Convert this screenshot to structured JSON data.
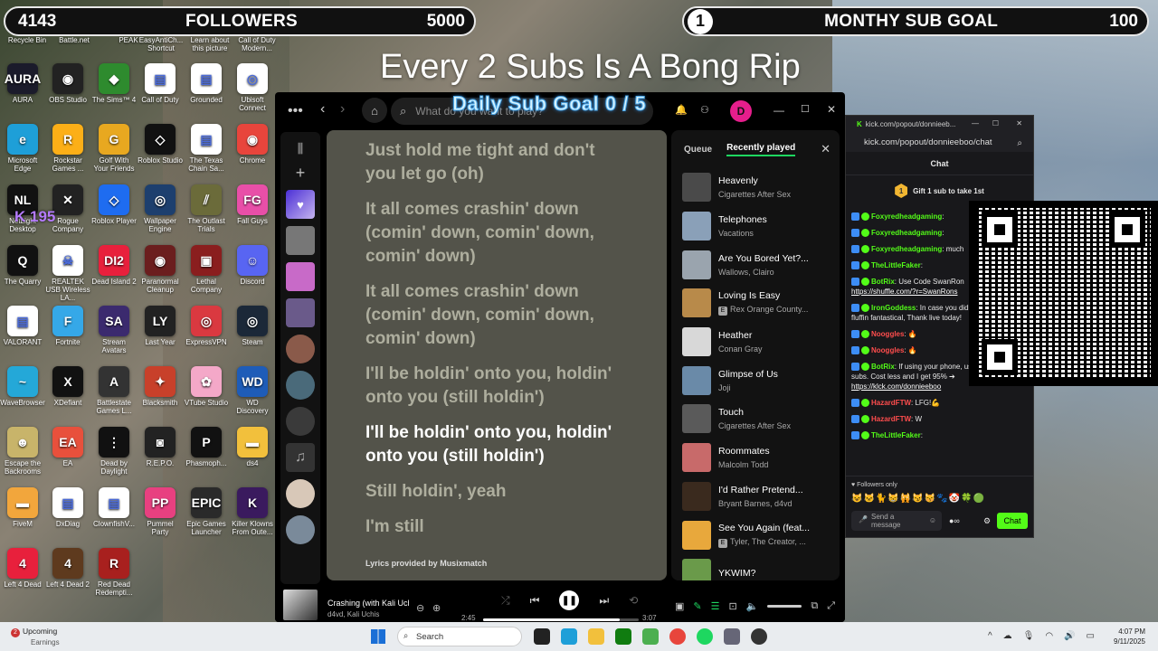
{
  "followers_bar": {
    "current": "4143",
    "title": "FOLLOWERS",
    "goal": "5000"
  },
  "sub_goal_bar": {
    "current": "1",
    "title": "MONTHY SUB GOAL",
    "goal": "100"
  },
  "overlay": {
    "caption": "Every 2 Subs Is A Bong Rip",
    "daily_goal": "Daily Sub Goal  0 / 5",
    "k_label": "K 195"
  },
  "desktop": {
    "top_row": [
      "Recycle Bin",
      "Battle.net",
      "PEAK",
      "EasyAntiCh... Shortcut",
      "Learn about this picture",
      "Call of Duty Modern..."
    ],
    "icons": [
      {
        "label": "AURA",
        "icon": "aura-icon",
        "color": "#1b1b2b",
        "text": "AURA"
      },
      {
        "label": "OBS Studio",
        "icon": "obs-icon",
        "color": "#222222",
        "text": "◉"
      },
      {
        "label": "The Sims™ 4",
        "icon": "sims-icon",
        "color": "#2e8b2e",
        "text": "◆"
      },
      {
        "label": "Call of Duty",
        "icon": "cod-icon",
        "color": "#ffffff",
        "text": "▤"
      },
      {
        "label": "Grounded",
        "icon": "grounded-icon",
        "color": "#ffffff",
        "text": "▤"
      },
      {
        "label": "Ubisoft Connect",
        "icon": "ubisoft-icon",
        "color": "#ffffff",
        "text": "◎"
      },
      {
        "label": "Microsoft Edge",
        "icon": "edge-icon",
        "color": "#1e9fd8",
        "text": "e"
      },
      {
        "label": "Rockstar Games ...",
        "icon": "rockstar-icon",
        "color": "#fcaf17",
        "text": "R"
      },
      {
        "label": "Golf With Your Friends",
        "icon": "golf-icon",
        "color": "#e8a820",
        "text": "G"
      },
      {
        "label": "Roblox Studio",
        "icon": "roblox-studio-icon",
        "color": "#111111",
        "text": "◇"
      },
      {
        "label": "The Texas Chain Sa...",
        "icon": "texas-icon",
        "color": "#ffffff",
        "text": "▤"
      },
      {
        "label": "Chrome",
        "icon": "chrome-icon",
        "color": "#e8453c",
        "text": "◉"
      },
      {
        "label": "NetLight Desktop",
        "icon": "nl-icon",
        "color": "#111111",
        "text": "NL"
      },
      {
        "label": "Rogue Company",
        "icon": "rogue-icon",
        "color": "#222222",
        "text": "✕"
      },
      {
        "label": "Roblox Player",
        "icon": "roblox-icon",
        "color": "#1e6cf0",
        "text": "◇"
      },
      {
        "label": "Wallpaper Engine",
        "icon": "wallpaper-icon",
        "color": "#1d3f6e",
        "text": "◎"
      },
      {
        "label": "The Outlast Trials",
        "icon": "outlast-icon",
        "color": "#6b6b3a",
        "text": "⫽"
      },
      {
        "label": "Fall Guys",
        "icon": "fallguys-icon",
        "color": "#e84fa8",
        "text": "FG"
      },
      {
        "label": "The Quarry",
        "icon": "quarry-icon",
        "color": "#111111",
        "text": "Q"
      },
      {
        "label": "REALTEK USB Wireless LA...",
        "icon": "realtek-icon",
        "color": "#ffffff",
        "text": "☠"
      },
      {
        "label": "Dead Island 2",
        "icon": "deadisland-icon",
        "color": "#e8203c",
        "text": "DI2"
      },
      {
        "label": "Paranormal Cleanup",
        "icon": "paranormal-icon",
        "color": "#6b1e1e",
        "text": "◉"
      },
      {
        "label": "Lethal Company",
        "icon": "lethal-icon",
        "color": "#8a1e1e",
        "text": "▣"
      },
      {
        "label": "Discord",
        "icon": "discord-icon",
        "color": "#5865f2",
        "text": "☺"
      },
      {
        "label": "VALORANT",
        "icon": "valorant-icon",
        "color": "#ffffff",
        "text": "▤"
      },
      {
        "label": "Fortnite",
        "icon": "fortnite-icon",
        "color": "#35a8e8",
        "text": "F"
      },
      {
        "label": "Stream Avatars",
        "icon": "streamavatars-icon",
        "color": "#3b2a6e",
        "text": "SA"
      },
      {
        "label": "Last Year",
        "icon": "lastyear-icon",
        "color": "#222222",
        "text": "LY"
      },
      {
        "label": "ExpressVPN",
        "icon": "expressvpn-icon",
        "color": "#da3940",
        "text": "◎"
      },
      {
        "label": "Steam",
        "icon": "steam-icon",
        "color": "#1b2838",
        "text": "◎"
      },
      {
        "label": "WaveBrowser",
        "icon": "wave-icon",
        "color": "#24a8d8",
        "text": "~"
      },
      {
        "label": "XDefiant",
        "icon": "xdefiant-icon",
        "color": "#111111",
        "text": "X"
      },
      {
        "label": "Battlestate Games L...",
        "icon": "battlestate-icon",
        "color": "#333333",
        "text": "A"
      },
      {
        "label": "Blacksmith",
        "icon": "blacksmith-icon",
        "color": "#c8402a",
        "text": "✦"
      },
      {
        "label": "VTube Studio",
        "icon": "vtube-icon",
        "color": "#f4a8c8",
        "text": "✿"
      },
      {
        "label": "WD Discovery",
        "icon": "wd-icon",
        "color": "#1e5cb8",
        "text": "WD"
      },
      {
        "label": "Escape the Backrooms",
        "icon": "backrooms-icon",
        "color": "#c8b46a",
        "text": "☻"
      },
      {
        "label": "EA",
        "icon": "ea-icon",
        "color": "#e8503c",
        "text": "EA"
      },
      {
        "label": "Dead by Daylight",
        "icon": "dbd-icon",
        "color": "#111111",
        "text": "⋮"
      },
      {
        "label": "R.E.P.O.",
        "icon": "repo-icon",
        "color": "#222222",
        "text": "◙"
      },
      {
        "label": "Phasmoph...",
        "icon": "phasmo-icon",
        "color": "#111111",
        "text": "P"
      },
      {
        "label": "ds4",
        "icon": "folder-icon",
        "color": "#f2c03c",
        "text": "▬"
      },
      {
        "label": "FiveM",
        "icon": "fivem-icon",
        "color": "#f2a63c",
        "text": "▬"
      },
      {
        "label": "DxDiag",
        "icon": "dxdiag-icon",
        "color": "#ffffff",
        "text": "▤"
      },
      {
        "label": "ClownfishV...",
        "icon": "clownfish-icon",
        "color": "#ffffff",
        "text": "▤"
      },
      {
        "label": "Pummel Party",
        "icon": "pummel-icon",
        "color": "#e84080",
        "text": "PP"
      },
      {
        "label": "Epic Games Launcher",
        "icon": "epic-icon",
        "color": "#2a2a2a",
        "text": "EPIC"
      },
      {
        "label": "Killer Klowns From Oute...",
        "icon": "klowns-icon",
        "color": "#3a1a5e",
        "text": "K"
      },
      {
        "label": "Left 4 Dead",
        "icon": "l4d-icon",
        "color": "#e8203c",
        "text": "4"
      },
      {
        "label": "Left 4 Dead 2",
        "icon": "l4d2-icon",
        "color": "#5e3a1e",
        "text": "4"
      },
      {
        "label": "Red Dead Redempti...",
        "icon": "rdr-icon",
        "color": "#a8201e",
        "text": "R"
      }
    ]
  },
  "spotify": {
    "search_placeholder": "What do you want to play?",
    "avatar_letter": "D",
    "lyrics": [
      {
        "text": "Just hold me tight and don't you let go (oh)",
        "active": false
      },
      {
        "text": "It all comes crashin' down (comin' down, comin' down, comin' down)",
        "active": false
      },
      {
        "text": "It all comes crashin' down (comin' down, comin' down, comin' down)",
        "active": false
      },
      {
        "text": "I'll be holdin' onto you, holdin' onto you (still holdin')",
        "active": false
      },
      {
        "text": "I'll be holdin' onto you, holdin' onto you (still holdin')",
        "active": true
      },
      {
        "text": "Still holdin', yeah",
        "active": false
      },
      {
        "text": "I'm still",
        "active": false
      }
    ],
    "lyrics_credit": "Lyrics provided by Musixmatch",
    "queue_tabs": [
      "Queue",
      "Recently played"
    ],
    "recently_played": [
      {
        "title": "Heavenly",
        "artist": "Cigarettes After Sex",
        "explicit": false,
        "color": "#4a4a4a"
      },
      {
        "title": "Telephones",
        "artist": "Vacations",
        "explicit": false,
        "color": "#8aa0b8"
      },
      {
        "title": "Are You Bored Yet?...",
        "artist": "Wallows, Clairo",
        "explicit": false,
        "color": "#9aa4ae"
      },
      {
        "title": "Loving Is Easy",
        "artist": "Rex Orange County...",
        "explicit": true,
        "color": "#b88a4a"
      },
      {
        "title": "Heather",
        "artist": "Conan Gray",
        "explicit": false,
        "color": "#d8d8d8"
      },
      {
        "title": "Glimpse of Us",
        "artist": "Joji",
        "explicit": false,
        "color": "#6a8aa8"
      },
      {
        "title": "Touch",
        "artist": "Cigarettes After Sex",
        "explicit": false,
        "color": "#5a5a5a"
      },
      {
        "title": "Roommates",
        "artist": "Malcolm Todd",
        "explicit": false,
        "color": "#c86a6a"
      },
      {
        "title": "I'd Rather Pretend...",
        "artist": "Bryant Barnes, d4vd",
        "explicit": false,
        "color": "#3a2a1e"
      },
      {
        "title": "See You Again (feat...",
        "artist": "Tyler, The Creator, ...",
        "explicit": true,
        "color": "#e8a83c"
      },
      {
        "title": "YKWIM?",
        "artist": "",
        "explicit": false,
        "color": "#6a9a4a"
      }
    ],
    "now_playing": {
      "title": "Crashing (with Kali Uchis)",
      "artist": "d4vd, Kali Uchis",
      "elapsed": "2:45",
      "duration": "3:07",
      "progress": 0.88
    }
  },
  "kick": {
    "window_title": "kick.com/popout/donnieeb...",
    "address": "kick.com/popout/donnieeboo/chat",
    "chat_header": "Chat",
    "gift_text": "Gift 1 sub to take 1st",
    "gift_coin": "1",
    "messages": [
      {
        "user": "Foxyredheadgaming",
        "text": "",
        "style": "normal"
      },
      {
        "user": "Foxyredheadgaming",
        "text": "",
        "style": "normal"
      },
      {
        "user": "Foxyredheadgaming",
        "text": " much",
        "style": "normal"
      },
      {
        "user": "TheLittleFaker",
        "text": "",
        "style": "normal"
      },
      {
        "user": "BotRix",
        "text": " Use Code SwanRon",
        "link": "https://shuffle.com/?r=SwanRons",
        "style": "bot"
      },
      {
        "user": "IronGoddess",
        "text": " In case you didn't your pretty fluffin fantastical, Thank live today!",
        "style": "normal"
      },
      {
        "user": "Nooggles",
        "text": " 🔥",
        "style": "red"
      },
      {
        "user": "Nooggles",
        "text": " 🔥",
        "style": "red"
      },
      {
        "user": "BotRix",
        "text": " If using your phone, use browser for subs. Cost less and I get 95% ➔",
        "link": "https://klck.com/donnieeboo",
        "style": "bot"
      },
      {
        "user": "HazardFTW",
        "text": " LFG!💪",
        "style": "red"
      },
      {
        "user": "HazardFTW",
        "text": " W",
        "style": "red"
      },
      {
        "user": "TheLittleFaker",
        "text": "",
        "style": "normal"
      }
    ],
    "followers_only": "Followers only",
    "emotes": "😺🐱🐈😸🙀😼😽🐾🤡🍀🟢",
    "send_placeholder": "Send a message",
    "chat_button": "Chat"
  },
  "taskbar": {
    "weather_title": "Upcoming",
    "weather_sub": "Earnings",
    "weather_badge": "2",
    "search": "Search",
    "time": "4:07 PM",
    "date": "9/11/2025"
  }
}
